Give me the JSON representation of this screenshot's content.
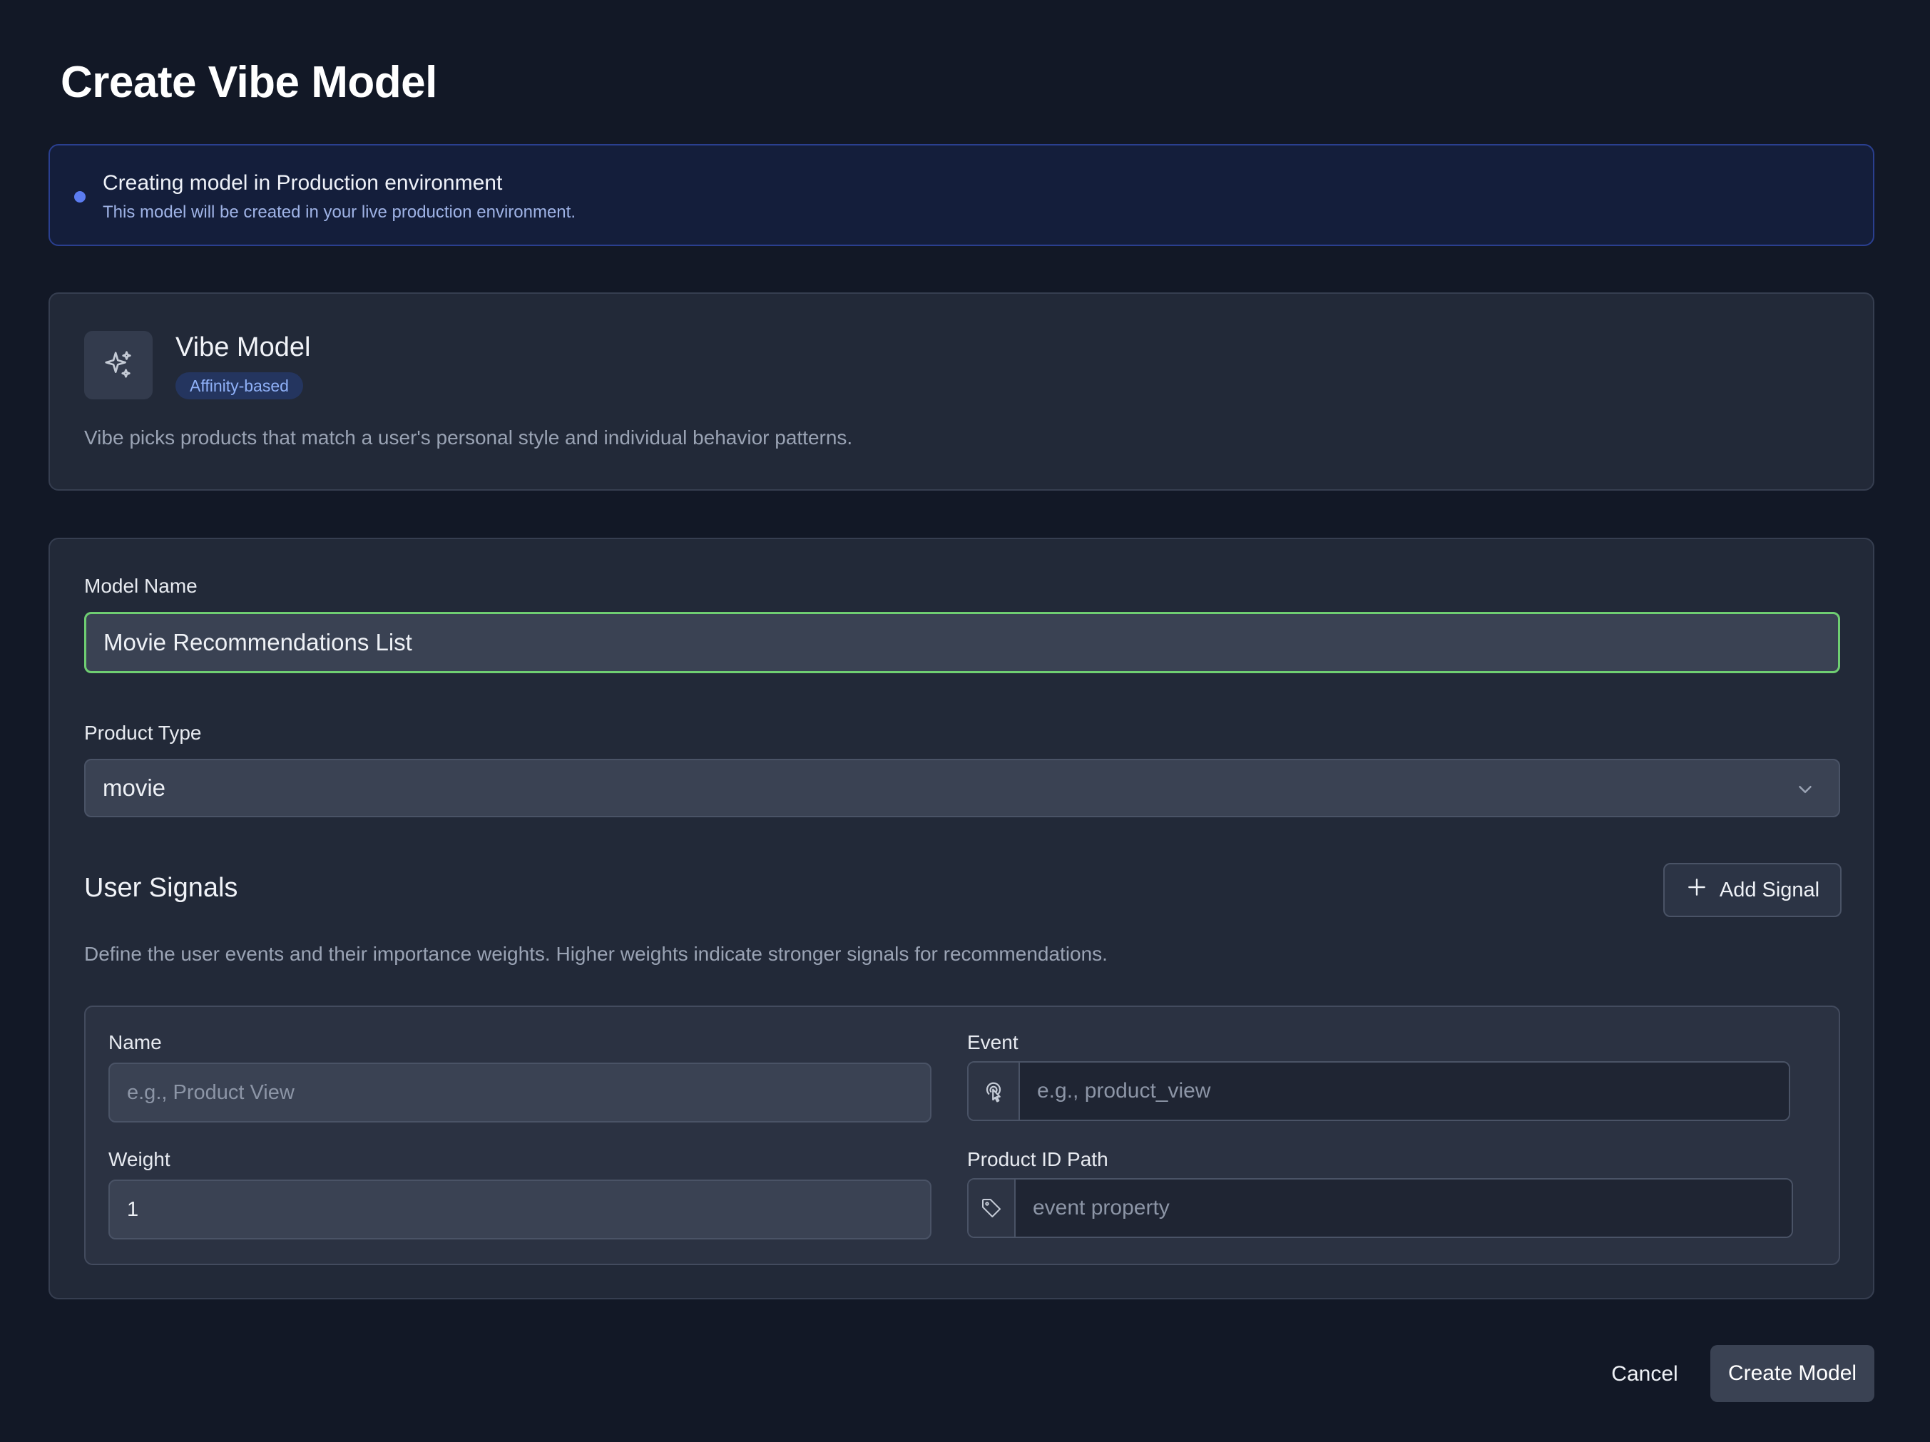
{
  "page": {
    "title": "Create Vibe Model"
  },
  "environment": {
    "title": "Creating model in Production environment",
    "subtitle": "This model will be created in your live production environment."
  },
  "model": {
    "icon": "sparkles-icon",
    "name": "Vibe Model",
    "badge": "Affinity-based",
    "description": "Vibe picks products that match a user's personal style and individual behavior patterns."
  },
  "form": {
    "model_name_label": "Model Name",
    "model_name_value": "Movie Recommendations List",
    "product_type_label": "Product Type",
    "product_type_value": "movie"
  },
  "signals": {
    "title": "User Signals",
    "add_label": "Add Signal",
    "description": "Define the user events and their importance weights. Higher weights indicate stronger signals for recommendations.",
    "name_label": "Name",
    "name_placeholder": "e.g., Product View",
    "event_label": "Event",
    "event_placeholder": "e.g., product_view",
    "weight_label": "Weight",
    "weight_value": "1",
    "product_id_label": "Product ID Path",
    "product_id_placeholder": "event property"
  },
  "footer": {
    "cancel_label": "Cancel",
    "create_label": "Create Model"
  },
  "colors": {
    "background": "#121826",
    "accent_blue": "#5b7cf0",
    "focus_green": "#6fce72"
  }
}
